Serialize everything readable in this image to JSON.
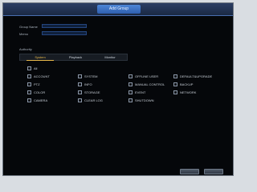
{
  "window": {
    "title": "Add Group"
  },
  "form": {
    "group_name_label": "Group Name",
    "memo_label": "Memo",
    "group_name_value": "",
    "memo_value": ""
  },
  "authority": {
    "label": "Authority",
    "tabs": [
      {
        "label": "System",
        "active": true
      },
      {
        "label": "Playback",
        "active": false
      },
      {
        "label": "Monitor",
        "active": false
      }
    ],
    "all_label": "All",
    "items": [
      {
        "label": "ACCOUNT"
      },
      {
        "label": "SYSTEM"
      },
      {
        "label": "OFFLINE USER"
      },
      {
        "label": "DEFAULT&UPGRADE"
      },
      {
        "label": "PTZ"
      },
      {
        "label": "INFO"
      },
      {
        "label": "MANUAL CONTROL"
      },
      {
        "label": "BACKUP"
      },
      {
        "label": "COLOR"
      },
      {
        "label": "STORAGE"
      },
      {
        "label": "EVENT"
      },
      {
        "label": "NETWORK"
      },
      {
        "label": "CAMERA"
      },
      {
        "label": "CLEAR LOG"
      },
      {
        "label": "SHUTDOWN"
      }
    ]
  },
  "footer": {
    "ok_label": "",
    "cancel_label": ""
  },
  "colors": {
    "background": "#05070a",
    "title_tab": "#2f5fb0",
    "active_tab": "#e6b84a",
    "text": "#c9d0d8"
  }
}
